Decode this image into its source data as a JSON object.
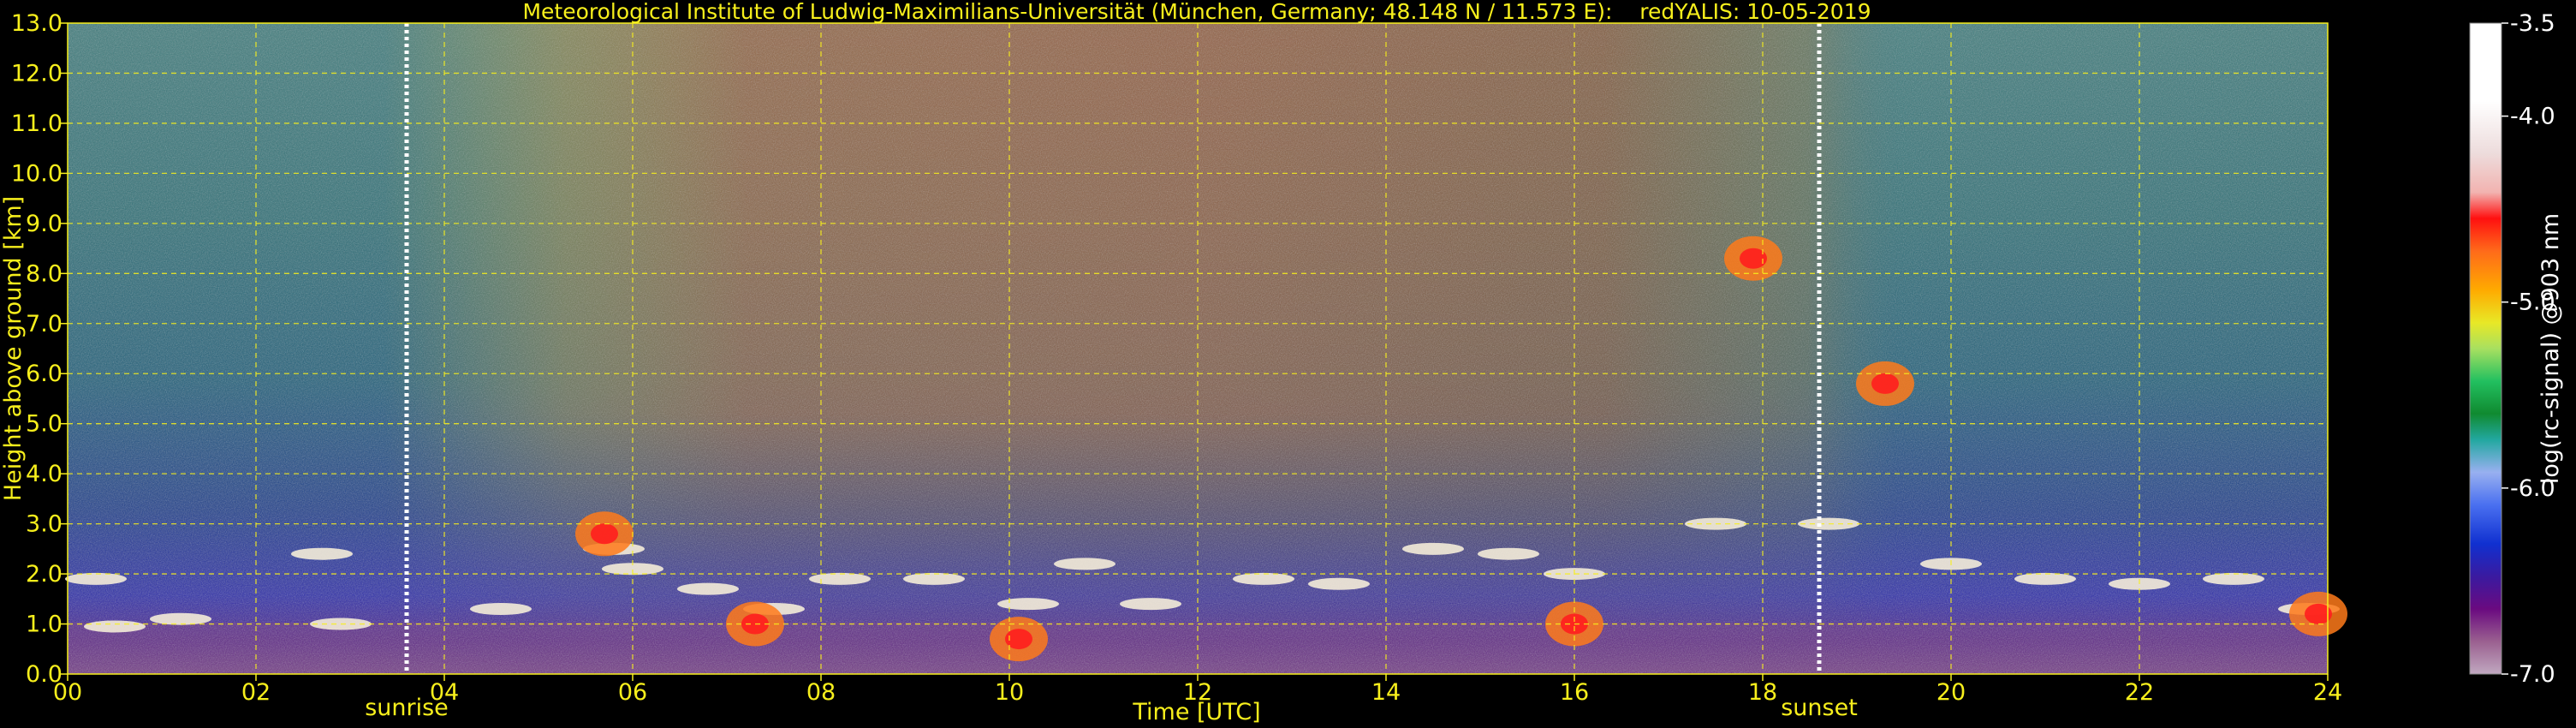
{
  "chart_data": {
    "type": "heatmap",
    "title": "Meteorological Institute of Ludwig-Maximilians-Universität (München, Germany; 48.148 N / 11.573 E):    redYALIS: 10-05-2019",
    "xlabel": "Time [UTC]",
    "ylabel": "Height above ground [km]",
    "xlim": [
      0,
      24
    ],
    "ylim": [
      0,
      13
    ],
    "x_ticks": [
      "00",
      "02",
      "04",
      "06",
      "08",
      "10",
      "12",
      "14",
      "16",
      "18",
      "20",
      "22",
      "24"
    ],
    "y_ticks": [
      "0.0",
      "1.0",
      "2.0",
      "3.0",
      "4.0",
      "5.0",
      "6.0",
      "7.0",
      "8.0",
      "9.0",
      "10.0",
      "11.0",
      "12.0",
      "13.0"
    ],
    "grid": true,
    "annotations": [
      {
        "label": "sunrise",
        "x": 3.6
      },
      {
        "label": "sunset",
        "x": 18.6
      }
    ],
    "colorbar": {
      "label": "log(rc-signal) @903 nm",
      "ticks": [
        "-3.5",
        "-4.0",
        "-5.0",
        "-6.0",
        "-7.0"
      ],
      "range": [
        -7.0,
        -3.5
      ]
    },
    "cloud_layers": [
      {
        "t": 0.3,
        "h": 1.9
      },
      {
        "t": 0.5,
        "h": 0.95
      },
      {
        "t": 1.2,
        "h": 1.1
      },
      {
        "t": 2.7,
        "h": 2.4
      },
      {
        "t": 2.9,
        "h": 1.0
      },
      {
        "t": 4.6,
        "h": 1.3
      },
      {
        "t": 5.8,
        "h": 2.5
      },
      {
        "t": 6.0,
        "h": 2.1
      },
      {
        "t": 6.8,
        "h": 1.7
      },
      {
        "t": 7.5,
        "h": 1.3
      },
      {
        "t": 8.2,
        "h": 1.9
      },
      {
        "t": 9.2,
        "h": 1.9
      },
      {
        "t": 10.2,
        "h": 1.4
      },
      {
        "t": 10.8,
        "h": 2.2
      },
      {
        "t": 11.5,
        "h": 1.4
      },
      {
        "t": 12.7,
        "h": 1.9
      },
      {
        "t": 13.5,
        "h": 1.8
      },
      {
        "t": 14.5,
        "h": 2.5
      },
      {
        "t": 15.3,
        "h": 2.4
      },
      {
        "t": 16.0,
        "h": 2.0
      },
      {
        "t": 17.5,
        "h": 3.0
      },
      {
        "t": 18.7,
        "h": 3.0
      },
      {
        "t": 20.0,
        "h": 2.2
      },
      {
        "t": 21.0,
        "h": 1.9
      },
      {
        "t": 22.0,
        "h": 1.8
      },
      {
        "t": 23.0,
        "h": 1.9
      },
      {
        "t": 23.8,
        "h": 1.3
      }
    ],
    "aerosol_features": [
      {
        "t": 5.7,
        "h": 2.8
      },
      {
        "t": 7.3,
        "h": 1.0
      },
      {
        "t": 10.1,
        "h": 0.7
      },
      {
        "t": 16.0,
        "h": 1.0
      },
      {
        "t": 17.9,
        "h": 8.3
      },
      {
        "t": 19.3,
        "h": 5.8
      },
      {
        "t": 23.9,
        "h": 1.2
      }
    ]
  }
}
